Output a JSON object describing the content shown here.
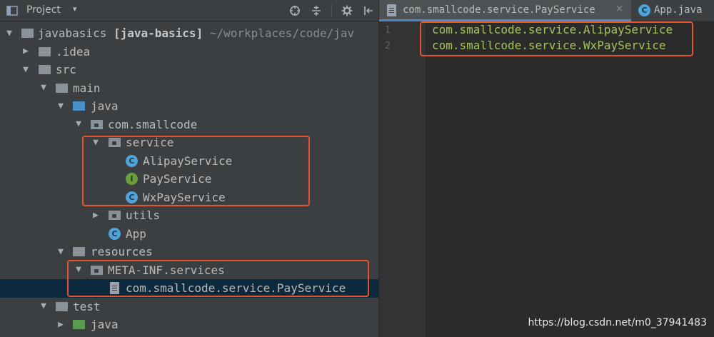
{
  "panel": {
    "title": "Project",
    "caret": "▾"
  },
  "tree": {
    "root": {
      "name": "javabasics",
      "module": "[java-basics]",
      "path": "~/workplaces/code/jav"
    },
    "idea": ".idea",
    "src": "src",
    "main": "main",
    "java": "java",
    "pkg": "com.smallcode",
    "service": "service",
    "alipay": "AlipayService",
    "payservice": "PayService",
    "wxpay": "WxPayService",
    "utils": "utils",
    "app": "App",
    "resources": "resources",
    "metainf": "META-INF.services",
    "spi_file": "com.smallcode.service.PayService",
    "test": "test",
    "test_java": "java"
  },
  "icons": {
    "class_badge": "C",
    "interface_badge": "I"
  },
  "editor": {
    "tabs": [
      {
        "label": "com.smallcode.service.PayService",
        "close": "×"
      },
      {
        "label": "App.java"
      }
    ],
    "lines": [
      {
        "number": "1",
        "text": "com.smallcode.service.AlipayService"
      },
      {
        "number": "2",
        "text": "com.smallcode.service.WxPayService"
      }
    ]
  },
  "watermark": "https://blog.csdn.net/m0_37941483",
  "colors": {
    "highlight": "#e4552d",
    "selection": "#0d293e",
    "code": "#a5c25c"
  }
}
